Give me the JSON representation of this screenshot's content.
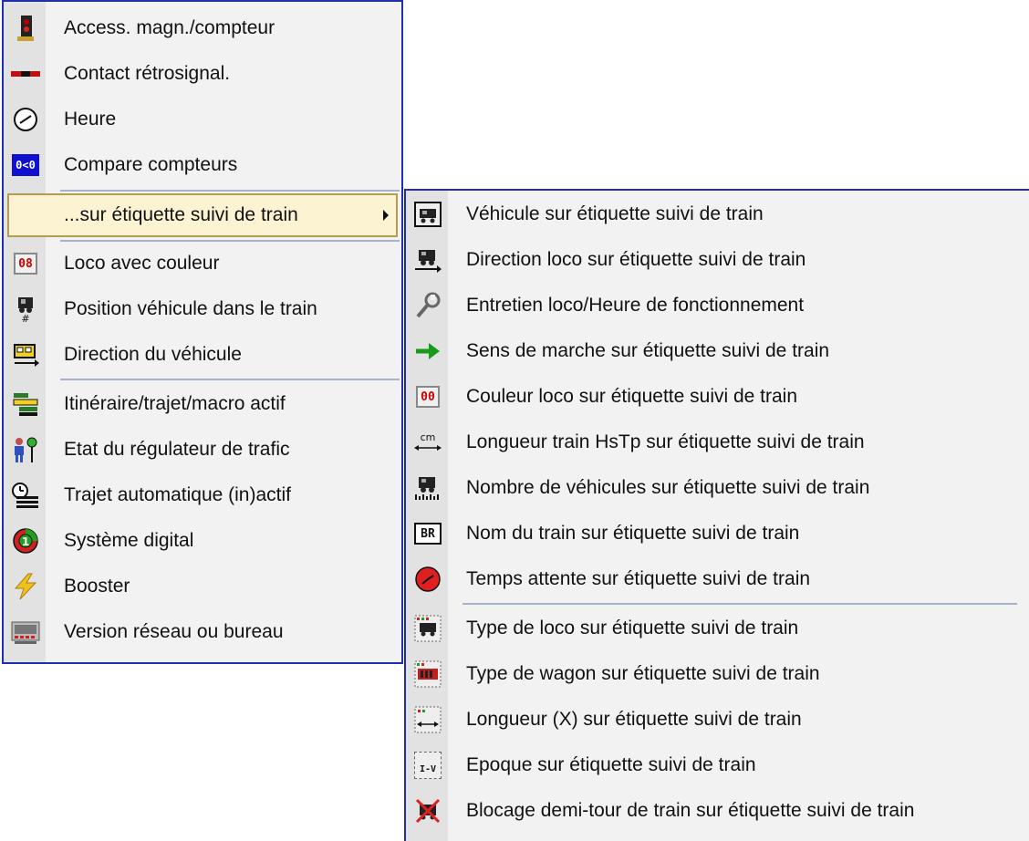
{
  "main_menu": {
    "items": [
      {
        "label": "Access. magn./compteur",
        "icon": "signal-icon"
      },
      {
        "label": "Contact rétrosignal.",
        "icon": "contact-icon"
      },
      {
        "label": "Heure",
        "icon": "clock-icon"
      },
      {
        "label": "Compare compteurs",
        "icon": "counter-compare-icon"
      },
      {
        "label": "...sur étiquette suivi de train",
        "icon": "",
        "has_submenu": true
      },
      {
        "label": "Loco avec couleur",
        "icon": "loco-color-icon",
        "badge": "08"
      },
      {
        "label": "Position véhicule dans le train",
        "icon": "vehicle-position-icon"
      },
      {
        "label": "Direction du véhicule",
        "icon": "vehicle-direction-icon"
      },
      {
        "label": "Itinéraire/trajet/macro actif",
        "icon": "route-icon"
      },
      {
        "label": "Etat du régulateur de trafic",
        "icon": "traffic-controller-icon"
      },
      {
        "label": "Trajet automatique (in)actif",
        "icon": "auto-route-icon"
      },
      {
        "label": "Système digital",
        "icon": "digital-system-icon"
      },
      {
        "label": "Booster",
        "icon": "booster-icon"
      },
      {
        "label": "Version réseau ou bureau",
        "icon": "version-icon"
      }
    ],
    "compare_badge": "0<0"
  },
  "sub_menu": {
    "items": [
      {
        "label": "Véhicule sur étiquette suivi de train",
        "icon": "vehicle-icon"
      },
      {
        "label": "Direction loco sur étiquette suivi de train",
        "icon": "loco-direction-icon"
      },
      {
        "label": "Entretien loco/Heure de fonctionnement",
        "icon": "wrench-icon"
      },
      {
        "label": "Sens de marche sur étiquette suivi de train",
        "icon": "arrow-right-icon"
      },
      {
        "label": "Couleur loco sur étiquette suivi de train",
        "icon": "loco-color-icon",
        "badge": "00"
      },
      {
        "label": "Longueur train HsTp sur étiquette suivi de train",
        "icon": "length-cm-icon",
        "badge": "cm"
      },
      {
        "label": "Nombre de véhicules sur étiquette suivi de train",
        "icon": "vehicle-count-icon"
      },
      {
        "label": "Nom du train sur étiquette suivi de train",
        "icon": "train-name-icon",
        "badge": "BR"
      },
      {
        "label": "Temps attente sur étiquette suivi de train",
        "icon": "wait-time-icon"
      },
      {
        "label": "Type de loco sur étiquette suivi de train",
        "icon": "loco-type-icon"
      },
      {
        "label": "Type de wagon sur étiquette suivi de train",
        "icon": "wagon-type-icon"
      },
      {
        "label": "Longueur (X) sur étiquette suivi de train",
        "icon": "length-x-icon"
      },
      {
        "label": "Epoque sur étiquette suivi de train",
        "icon": "epoch-icon",
        "badge": "I-V"
      },
      {
        "label": "Blocage demi-tour de train sur étiquette suivi de train",
        "icon": "block-reverse-icon"
      }
    ]
  },
  "colors": {
    "menu_bg": "#f2f2f2",
    "gutter": "#e2e2e2",
    "border": "#1f2fb0",
    "highlight_bg": "#fcf3d2",
    "highlight_border": "#b29d52",
    "separator": "#a9b3c9"
  }
}
